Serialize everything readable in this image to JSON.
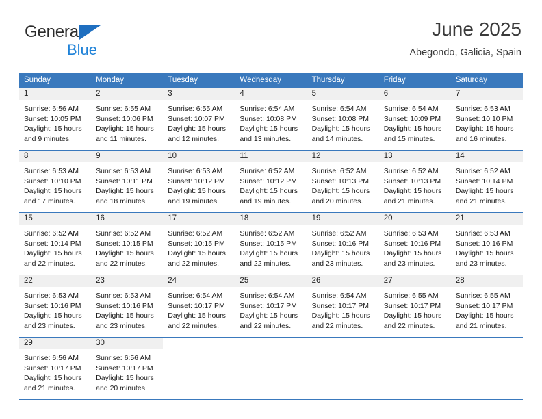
{
  "brand": {
    "name_top": "General",
    "name_bottom": "Blue",
    "icon": "triangle-logo-icon",
    "color_top": "#2b2b2b",
    "color_bottom": "#1f82d8",
    "triangle_color": "#1f6fc0"
  },
  "header": {
    "title": "June 2025",
    "subtitle": "Abegondo, Galicia, Spain"
  },
  "theme": {
    "header_blue": "#3a79bd",
    "daynum_gray": "#f0f0f0",
    "text": "#1c1c1c"
  },
  "calendar": {
    "weekdays": [
      "Sunday",
      "Monday",
      "Tuesday",
      "Wednesday",
      "Thursday",
      "Friday",
      "Saturday"
    ],
    "weeks": [
      [
        {
          "day": "1",
          "sunrise": "Sunrise: 6:56 AM",
          "sunset": "Sunset: 10:05 PM",
          "daylight1": "Daylight: 15 hours",
          "daylight2": "and 9 minutes."
        },
        {
          "day": "2",
          "sunrise": "Sunrise: 6:55 AM",
          "sunset": "Sunset: 10:06 PM",
          "daylight1": "Daylight: 15 hours",
          "daylight2": "and 11 minutes."
        },
        {
          "day": "3",
          "sunrise": "Sunrise: 6:55 AM",
          "sunset": "Sunset: 10:07 PM",
          "daylight1": "Daylight: 15 hours",
          "daylight2": "and 12 minutes."
        },
        {
          "day": "4",
          "sunrise": "Sunrise: 6:54 AM",
          "sunset": "Sunset: 10:08 PM",
          "daylight1": "Daylight: 15 hours",
          "daylight2": "and 13 minutes."
        },
        {
          "day": "5",
          "sunrise": "Sunrise: 6:54 AM",
          "sunset": "Sunset: 10:08 PM",
          "daylight1": "Daylight: 15 hours",
          "daylight2": "and 14 minutes."
        },
        {
          "day": "6",
          "sunrise": "Sunrise: 6:54 AM",
          "sunset": "Sunset: 10:09 PM",
          "daylight1": "Daylight: 15 hours",
          "daylight2": "and 15 minutes."
        },
        {
          "day": "7",
          "sunrise": "Sunrise: 6:53 AM",
          "sunset": "Sunset: 10:10 PM",
          "daylight1": "Daylight: 15 hours",
          "daylight2": "and 16 minutes."
        }
      ],
      [
        {
          "day": "8",
          "sunrise": "Sunrise: 6:53 AM",
          "sunset": "Sunset: 10:10 PM",
          "daylight1": "Daylight: 15 hours",
          "daylight2": "and 17 minutes."
        },
        {
          "day": "9",
          "sunrise": "Sunrise: 6:53 AM",
          "sunset": "Sunset: 10:11 PM",
          "daylight1": "Daylight: 15 hours",
          "daylight2": "and 18 minutes."
        },
        {
          "day": "10",
          "sunrise": "Sunrise: 6:53 AM",
          "sunset": "Sunset: 10:12 PM",
          "daylight1": "Daylight: 15 hours",
          "daylight2": "and 19 minutes."
        },
        {
          "day": "11",
          "sunrise": "Sunrise: 6:52 AM",
          "sunset": "Sunset: 10:12 PM",
          "daylight1": "Daylight: 15 hours",
          "daylight2": "and 19 minutes."
        },
        {
          "day": "12",
          "sunrise": "Sunrise: 6:52 AM",
          "sunset": "Sunset: 10:13 PM",
          "daylight1": "Daylight: 15 hours",
          "daylight2": "and 20 minutes."
        },
        {
          "day": "13",
          "sunrise": "Sunrise: 6:52 AM",
          "sunset": "Sunset: 10:13 PM",
          "daylight1": "Daylight: 15 hours",
          "daylight2": "and 21 minutes."
        },
        {
          "day": "14",
          "sunrise": "Sunrise: 6:52 AM",
          "sunset": "Sunset: 10:14 PM",
          "daylight1": "Daylight: 15 hours",
          "daylight2": "and 21 minutes."
        }
      ],
      [
        {
          "day": "15",
          "sunrise": "Sunrise: 6:52 AM",
          "sunset": "Sunset: 10:14 PM",
          "daylight1": "Daylight: 15 hours",
          "daylight2": "and 22 minutes."
        },
        {
          "day": "16",
          "sunrise": "Sunrise: 6:52 AM",
          "sunset": "Sunset: 10:15 PM",
          "daylight1": "Daylight: 15 hours",
          "daylight2": "and 22 minutes."
        },
        {
          "day": "17",
          "sunrise": "Sunrise: 6:52 AM",
          "sunset": "Sunset: 10:15 PM",
          "daylight1": "Daylight: 15 hours",
          "daylight2": "and 22 minutes."
        },
        {
          "day": "18",
          "sunrise": "Sunrise: 6:52 AM",
          "sunset": "Sunset: 10:15 PM",
          "daylight1": "Daylight: 15 hours",
          "daylight2": "and 22 minutes."
        },
        {
          "day": "19",
          "sunrise": "Sunrise: 6:52 AM",
          "sunset": "Sunset: 10:16 PM",
          "daylight1": "Daylight: 15 hours",
          "daylight2": "and 23 minutes."
        },
        {
          "day": "20",
          "sunrise": "Sunrise: 6:53 AM",
          "sunset": "Sunset: 10:16 PM",
          "daylight1": "Daylight: 15 hours",
          "daylight2": "and 23 minutes."
        },
        {
          "day": "21",
          "sunrise": "Sunrise: 6:53 AM",
          "sunset": "Sunset: 10:16 PM",
          "daylight1": "Daylight: 15 hours",
          "daylight2": "and 23 minutes."
        }
      ],
      [
        {
          "day": "22",
          "sunrise": "Sunrise: 6:53 AM",
          "sunset": "Sunset: 10:16 PM",
          "daylight1": "Daylight: 15 hours",
          "daylight2": "and 23 minutes."
        },
        {
          "day": "23",
          "sunrise": "Sunrise: 6:53 AM",
          "sunset": "Sunset: 10:16 PM",
          "daylight1": "Daylight: 15 hours",
          "daylight2": "and 23 minutes."
        },
        {
          "day": "24",
          "sunrise": "Sunrise: 6:54 AM",
          "sunset": "Sunset: 10:17 PM",
          "daylight1": "Daylight: 15 hours",
          "daylight2": "and 22 minutes."
        },
        {
          "day": "25",
          "sunrise": "Sunrise: 6:54 AM",
          "sunset": "Sunset: 10:17 PM",
          "daylight1": "Daylight: 15 hours",
          "daylight2": "and 22 minutes."
        },
        {
          "day": "26",
          "sunrise": "Sunrise: 6:54 AM",
          "sunset": "Sunset: 10:17 PM",
          "daylight1": "Daylight: 15 hours",
          "daylight2": "and 22 minutes."
        },
        {
          "day": "27",
          "sunrise": "Sunrise: 6:55 AM",
          "sunset": "Sunset: 10:17 PM",
          "daylight1": "Daylight: 15 hours",
          "daylight2": "and 22 minutes."
        },
        {
          "day": "28",
          "sunrise": "Sunrise: 6:55 AM",
          "sunset": "Sunset: 10:17 PM",
          "daylight1": "Daylight: 15 hours",
          "daylight2": "and 21 minutes."
        }
      ],
      [
        {
          "day": "29",
          "sunrise": "Sunrise: 6:56 AM",
          "sunset": "Sunset: 10:17 PM",
          "daylight1": "Daylight: 15 hours",
          "daylight2": "and 21 minutes."
        },
        {
          "day": "30",
          "sunrise": "Sunrise: 6:56 AM",
          "sunset": "Sunset: 10:17 PM",
          "daylight1": "Daylight: 15 hours",
          "daylight2": "and 20 minutes."
        },
        {
          "day": "",
          "sunrise": "",
          "sunset": "",
          "daylight1": "",
          "daylight2": ""
        },
        {
          "day": "",
          "sunrise": "",
          "sunset": "",
          "daylight1": "",
          "daylight2": ""
        },
        {
          "day": "",
          "sunrise": "",
          "sunset": "",
          "daylight1": "",
          "daylight2": ""
        },
        {
          "day": "",
          "sunrise": "",
          "sunset": "",
          "daylight1": "",
          "daylight2": ""
        },
        {
          "day": "",
          "sunrise": "",
          "sunset": "",
          "daylight1": "",
          "daylight2": ""
        }
      ]
    ]
  }
}
